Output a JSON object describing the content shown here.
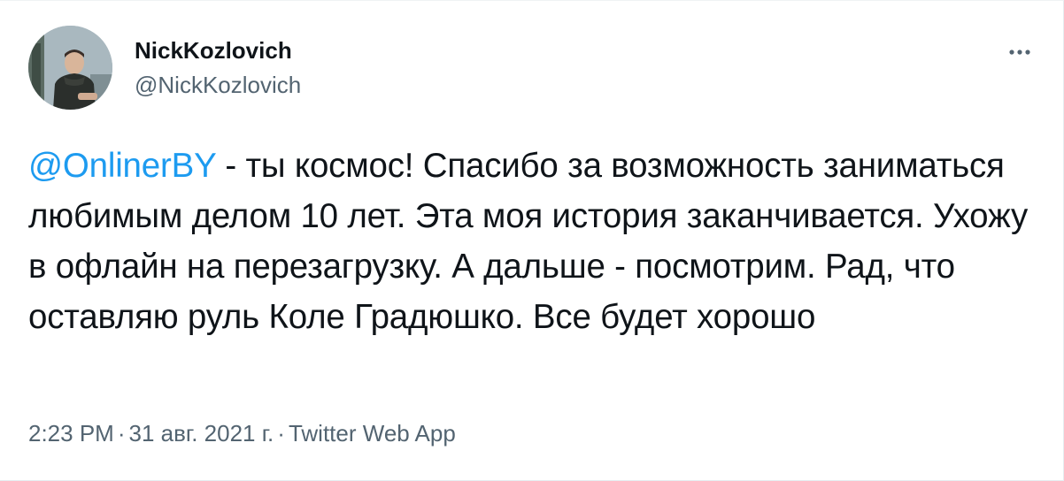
{
  "tweet": {
    "author": {
      "display_name": "NickKozlovich",
      "handle": "@NickKozlovich"
    },
    "mention": "@OnlinerBY",
    "text_after_mention": " - ты космос! Спасибо за возможность заниматься любимым делом 10 лет. Эта моя история заканчивается. Ухожу в офлайн на перезагрузку. А дальше - посмотрим. Рад, что оставляю руль Коле Градюшко. Все будет хорошо",
    "time": "2:23 PM",
    "separator": "·",
    "date": "31 авг. 2021 г.",
    "source": "Twitter Web App"
  },
  "icons": {
    "more": "more-horizontal-icon",
    "avatar": "profile-photo"
  },
  "colors": {
    "accent": "#1d9bf0",
    "text": "#0f1419",
    "secondary": "#536471"
  }
}
